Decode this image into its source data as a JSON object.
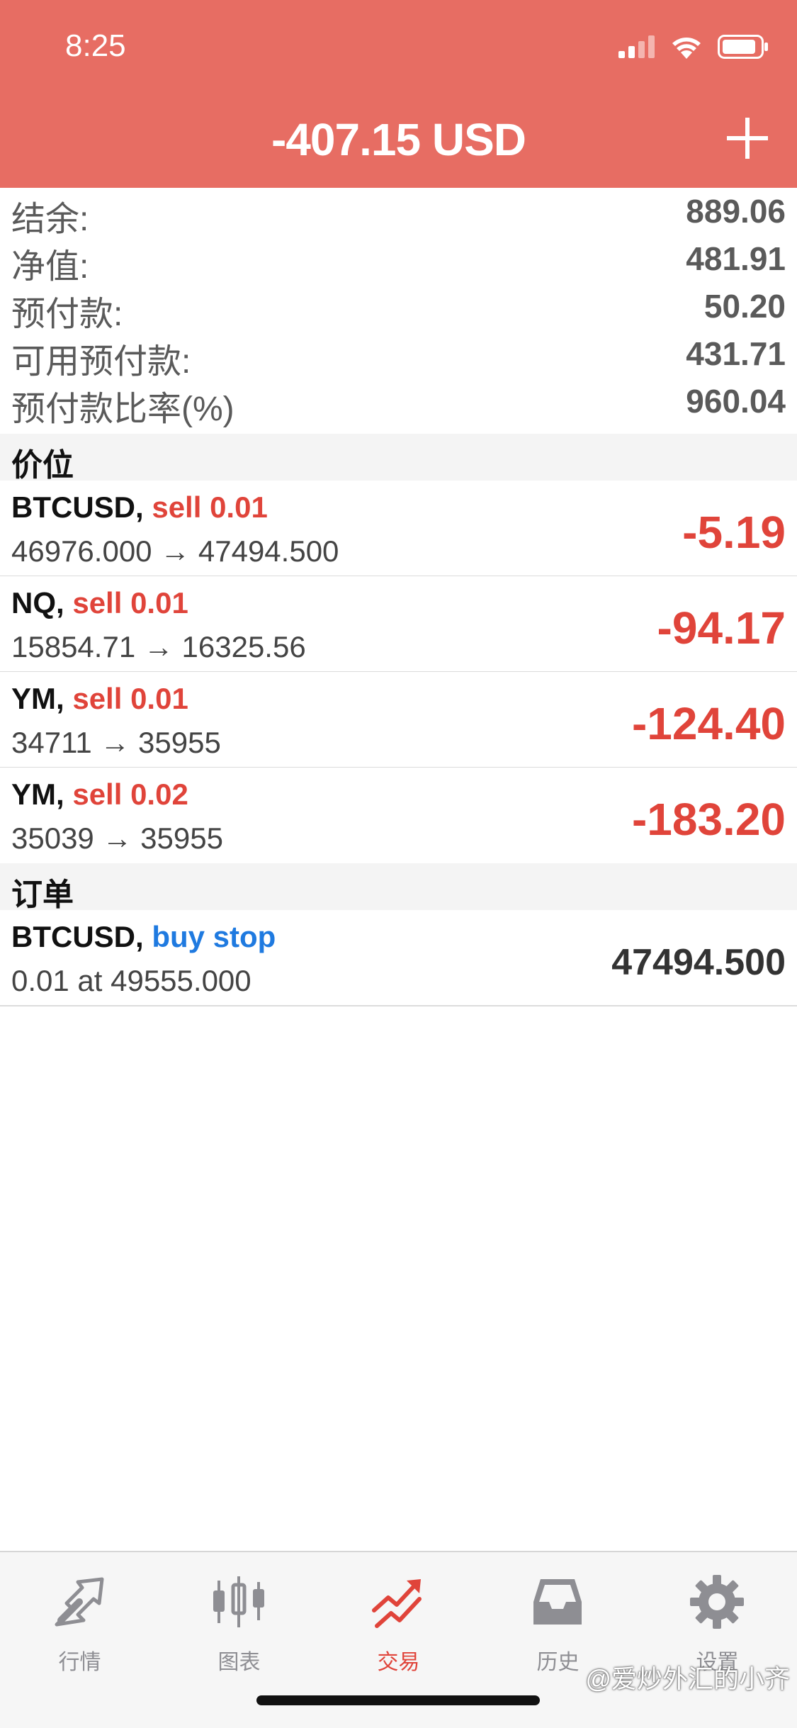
{
  "status_bar": {
    "time": "8:25"
  },
  "header": {
    "balance": "-407.15 USD"
  },
  "summary": [
    {
      "label": "结余:",
      "value": "889.06"
    },
    {
      "label": "净值:",
      "value": "481.91"
    },
    {
      "label": "预付款:",
      "value": "50.20"
    },
    {
      "label": "可用预付款:",
      "value": "431.71"
    },
    {
      "label": "预付款比率(%)",
      "value": "960.04"
    }
  ],
  "positions_section": {
    "label": "价位"
  },
  "positions": [
    {
      "symbol": "BTCUSD,",
      "side": "sell 0.01",
      "prices": "46976.000 → 47494.500",
      "profit": "-5.19"
    },
    {
      "symbol": "NQ,",
      "side": "sell 0.01",
      "prices": "15854.71 → 16325.56",
      "profit": "-94.17"
    },
    {
      "symbol": "YM,",
      "side": "sell 0.01",
      "prices": "34711 → 35955",
      "profit": "-124.40"
    },
    {
      "symbol": "YM,",
      "side": "sell 0.02",
      "prices": "35039 → 35955",
      "profit": "-183.20"
    }
  ],
  "orders_section": {
    "label": "订单"
  },
  "orders": [
    {
      "symbol": "BTCUSD,",
      "type": "buy stop",
      "details": "0.01 at 49555.000",
      "price": "47494.500"
    }
  ],
  "tabs": [
    {
      "label": "行情",
      "icon": "quotes-arrow-icon"
    },
    {
      "label": "图表",
      "icon": "candlestick-icon"
    },
    {
      "label": "交易",
      "icon": "trade-chart-icon"
    },
    {
      "label": "历史",
      "icon": "inbox-tray-icon"
    },
    {
      "label": "设置",
      "icon": "gear-icon"
    }
  ],
  "active_tab": 2,
  "watermark": "@爱炒外汇的小齐",
  "colors": {
    "header": "#e76d63",
    "sell": "#e0443a",
    "buy": "#1f7ae0",
    "tab_inactive": "#8e8e93"
  }
}
